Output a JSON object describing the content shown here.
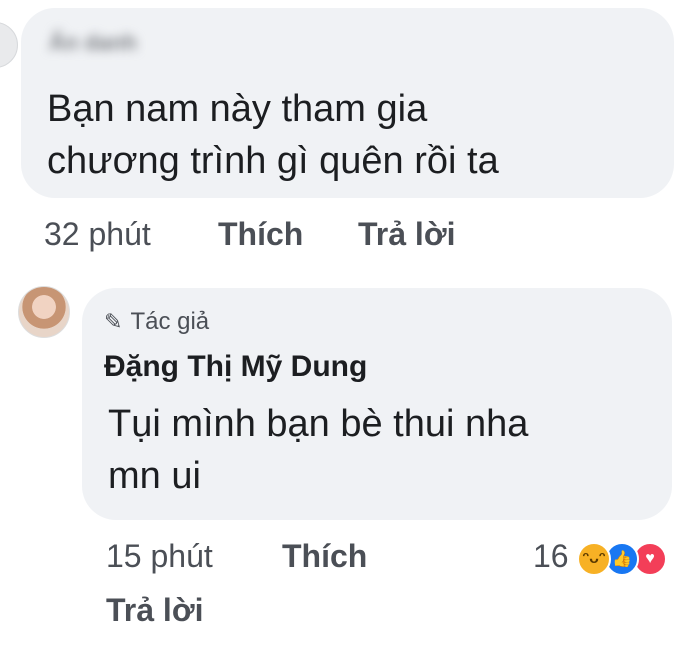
{
  "comments": [
    {
      "author_name_blurred": "Ẩn danh",
      "text_lines": [
        "Bạn nam này tham gia",
        "chương trình gì quên rồi ta"
      ],
      "time": "32 phút",
      "like_label": "Thích",
      "reply_label": "Trả lời"
    },
    {
      "author_badge": "Tác giả",
      "author_name": "Đặng Thị Mỹ Dung",
      "text_lines": [
        "Tụi mình bạn bè thui nha",
        "mn ui"
      ],
      "time": "15 phút",
      "like_label": "Thích",
      "reply_label": "Trả lời",
      "reaction_count": "16",
      "reaction_icons": [
        "haha-icon",
        "like-icon",
        "love-icon"
      ]
    }
  ],
  "colors": {
    "bubble_bg": "#f0f2f5",
    "text": "#1c1e21",
    "secondary_text": "#4b4f56",
    "like_blue": "#1877f2",
    "love_red": "#f33e58",
    "haha_yellow": "#f7b125"
  }
}
